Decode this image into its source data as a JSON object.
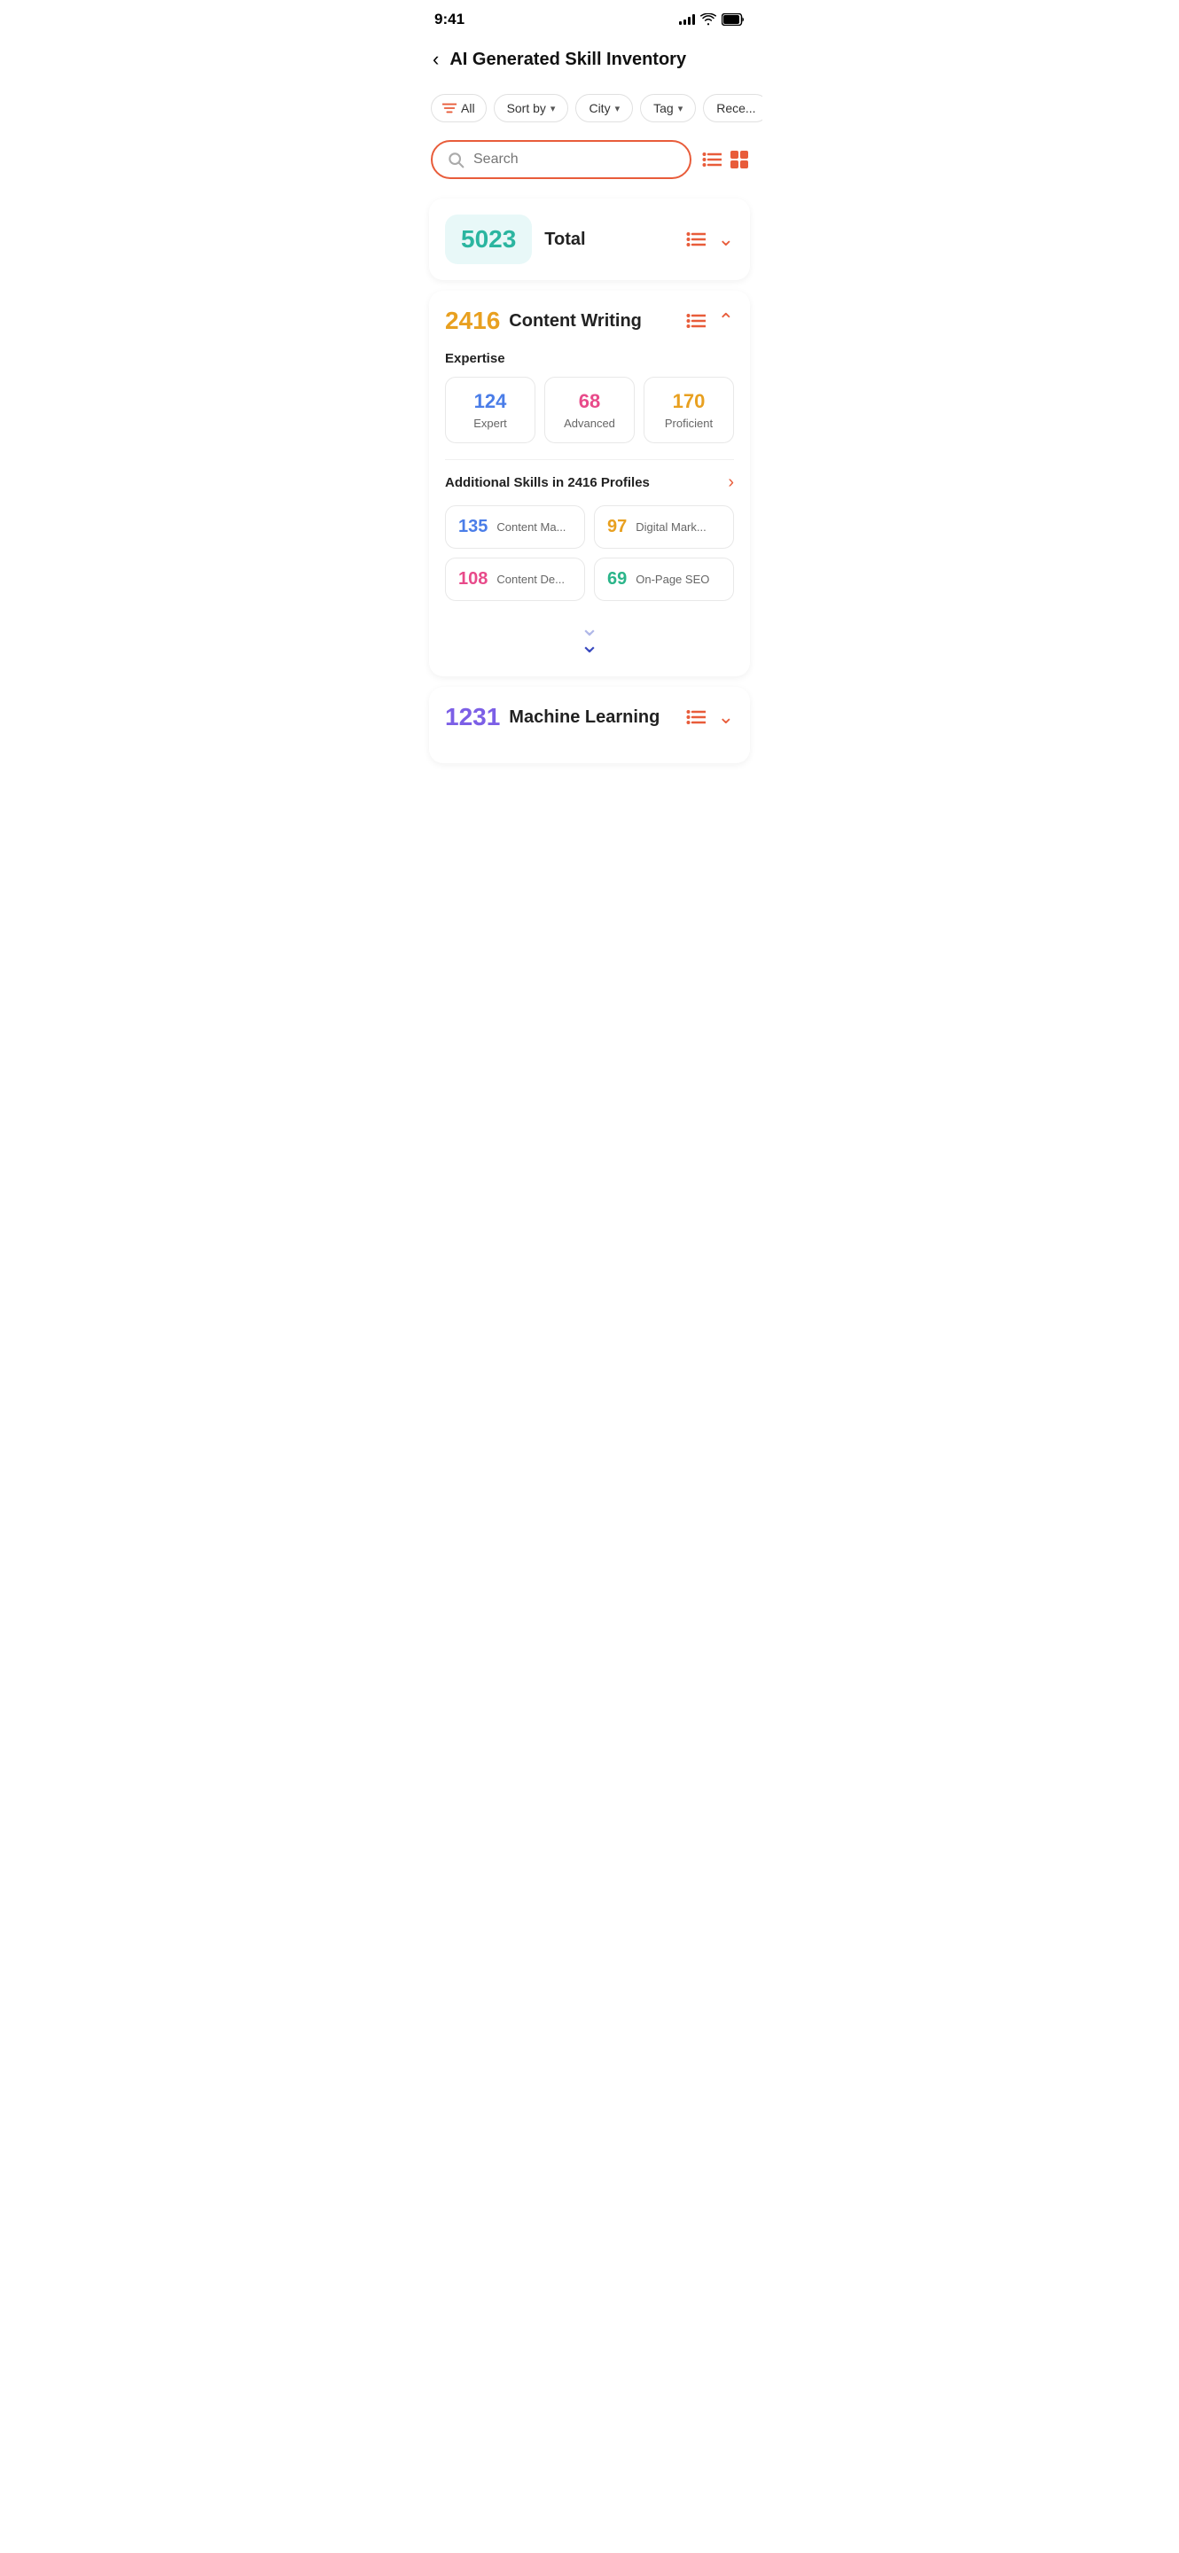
{
  "statusBar": {
    "time": "9:41",
    "signalBars": [
      4,
      6,
      8,
      10,
      12
    ],
    "wifiSymbol": "wifi",
    "batterySymbol": "battery"
  },
  "header": {
    "backLabel": "‹",
    "title": "AI Generated Skill Inventory"
  },
  "filters": {
    "allLabel": "All",
    "sortByLabel": "Sort by",
    "cityLabel": "City",
    "tagLabel": "Tag",
    "recentLabel": "Rece..."
  },
  "search": {
    "placeholder": "Search",
    "listViewLabel": "list-view",
    "gridViewLabel": "grid-view"
  },
  "totalCard": {
    "number": "5023",
    "label": "Total"
  },
  "contentWritingCard": {
    "number": "2416",
    "skillName": "Content Writing",
    "expertiseLabel": "Expertise",
    "expertiseItems": [
      {
        "count": "124",
        "type": "Expert",
        "colorClass": "expertise-count-blue"
      },
      {
        "count": "68",
        "type": "Advanced",
        "colorClass": "expertise-count-pink"
      },
      {
        "count": "170",
        "type": "Proficient",
        "colorClass": "expertise-count-orange"
      }
    ],
    "additionalSkillsTitle": "Additional Skills in 2416 Profiles",
    "additionalSkills": [
      {
        "count": "135",
        "name": "Content Ma...",
        "colorClass": "skill-item-count-blue"
      },
      {
        "count": "97",
        "name": "Digital Mark...",
        "colorClass": "skill-item-count-orange"
      },
      {
        "count": "108",
        "name": "Content De...",
        "colorClass": "skill-item-count-pink"
      },
      {
        "count": "69",
        "name": "On-Page SEO",
        "colorClass": "skill-item-count-green"
      }
    ]
  },
  "machineLearningCard": {
    "number": "1231",
    "skillName": "Machine Learning"
  },
  "loadMore": {
    "arrow1": "⌄",
    "arrow2": "⌄"
  }
}
